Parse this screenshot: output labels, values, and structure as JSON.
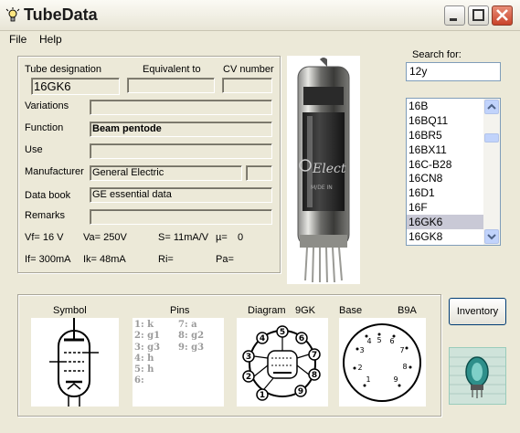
{
  "window": {
    "title": "TubeData",
    "icon": "bulb-icon"
  },
  "menu": {
    "file": "File",
    "help": "Help"
  },
  "labels": {
    "tube_designation": "Tube designation",
    "equivalent_to": "Equivalent to",
    "cv_number": "CV number",
    "variations": "Variations",
    "function": "Function",
    "use": "Use",
    "manufacturer": "Manufacturer",
    "data_book": "Data book",
    "remarks": "Remarks"
  },
  "fields": {
    "tube_designation": "16GK6",
    "equivalent_to": "",
    "cv_number": "",
    "variations": "",
    "function": "Beam pentode",
    "use": "",
    "manufacturer": "General Electric",
    "manufacturer_extra": "",
    "data_book": "GE essential data",
    "remarks": ""
  },
  "params": {
    "vf": "Vf= 16 V",
    "va": "Va= 250V",
    "s": "S= 11mA/V",
    "mu": "µ=",
    "mu_val": "0",
    "if": "If= 300mA",
    "ik": "Ik= 48mA",
    "ri": "Ri=",
    "pa": "Pa="
  },
  "search": {
    "label": "Search for:",
    "value": "12y"
  },
  "tube_list": [
    "16B",
    "16BQ11",
    "16BR5",
    "16BX11",
    "16C-B28",
    "16CN8",
    "16D1",
    "16F",
    "16GK6",
    "16GK8"
  ],
  "selected_index": 8,
  "bottom": {
    "symbol": "Symbol",
    "pins": "Pins",
    "diagram": "Diagram",
    "diagram_code": "9GK",
    "base": "Base",
    "base_code": "B9A"
  },
  "pins_left": [
    "1: k",
    "2: g1",
    "3: g3",
    "4: h",
    "5: h",
    "6:"
  ],
  "pins_right": [
    "7: a",
    "8: g2",
    "9: g3"
  ],
  "inventory_button": "Inventory",
  "tube_photo_text": "Elect",
  "tube_photo_subtext": "M/DE IN"
}
